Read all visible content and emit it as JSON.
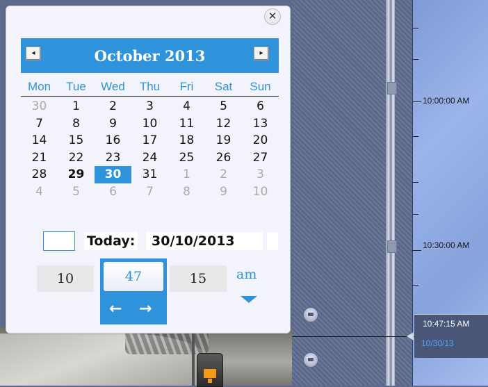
{
  "calendar": {
    "month_title": "October 2013",
    "prev_icon": "◂",
    "next_icon": "▸",
    "close_icon": "✕",
    "weekdays": [
      "Mon",
      "Tue",
      "Wed",
      "Thu",
      "Fri",
      "Sat",
      "Sun"
    ],
    "weeks": [
      [
        {
          "d": "30",
          "muted": true
        },
        {
          "d": "1"
        },
        {
          "d": "2"
        },
        {
          "d": "3"
        },
        {
          "d": "4"
        },
        {
          "d": "5"
        },
        {
          "d": "6"
        }
      ],
      [
        {
          "d": "7"
        },
        {
          "d": "8"
        },
        {
          "d": "9"
        },
        {
          "d": "10"
        },
        {
          "d": "11"
        },
        {
          "d": "12"
        },
        {
          "d": "13"
        }
      ],
      [
        {
          "d": "14"
        },
        {
          "d": "15"
        },
        {
          "d": "16"
        },
        {
          "d": "17"
        },
        {
          "d": "18"
        },
        {
          "d": "19"
        },
        {
          "d": "20"
        }
      ],
      [
        {
          "d": "21"
        },
        {
          "d": "22"
        },
        {
          "d": "23"
        },
        {
          "d": "24"
        },
        {
          "d": "25"
        },
        {
          "d": "26"
        },
        {
          "d": "27"
        }
      ],
      [
        {
          "d": "28"
        },
        {
          "d": "29",
          "bold": true
        },
        {
          "d": "30",
          "selected": true
        },
        {
          "d": "31"
        },
        {
          "d": "1",
          "muted": true
        },
        {
          "d": "2",
          "muted": true
        },
        {
          "d": "3",
          "muted": true
        }
      ],
      [
        {
          "d": "4",
          "muted": true
        },
        {
          "d": "5",
          "muted": true
        },
        {
          "d": "6",
          "muted": true
        },
        {
          "d": "7",
          "muted": true
        },
        {
          "d": "8",
          "muted": true
        },
        {
          "d": "9",
          "muted": true
        },
        {
          "d": "10",
          "muted": true
        }
      ]
    ],
    "today_label": "Today:",
    "today_value": "30/10/2013"
  },
  "time": {
    "hour": "10",
    "minute": "47",
    "second": "15",
    "ampm": "am",
    "left_arrow": "←",
    "right_arrow": "→"
  },
  "timeline": {
    "labels": [
      "10:00:00 AM",
      "10:30:00 AM"
    ],
    "cursor_time": "10:47:15 AM",
    "cursor_date": "10/30/13"
  },
  "colors": {
    "accent": "#2f93dc",
    "muted": "#a9a9a9"
  }
}
